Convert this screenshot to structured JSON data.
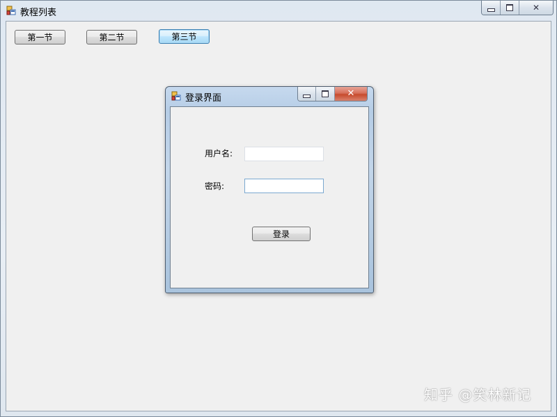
{
  "main_window": {
    "title": "教程列表",
    "buttons": [
      {
        "label": "第一节"
      },
      {
        "label": "第二节"
      },
      {
        "label": "第三节"
      }
    ]
  },
  "login_dialog": {
    "title": "登录界面",
    "username_label": "用户名:",
    "username_value": "",
    "password_label": "密码:",
    "password_value": "",
    "login_button": "登录"
  },
  "watermark": "知乎 @笑林新记",
  "icons": {
    "app_icon": "winforms-app-icon",
    "minimize": "minimize-icon",
    "maximize": "maximize-icon",
    "close": "close-icon"
  },
  "colors": {
    "window_background": "#f0f0f0",
    "close_button": "#c74b2d",
    "focused_button_border": "#3c7fb1"
  }
}
